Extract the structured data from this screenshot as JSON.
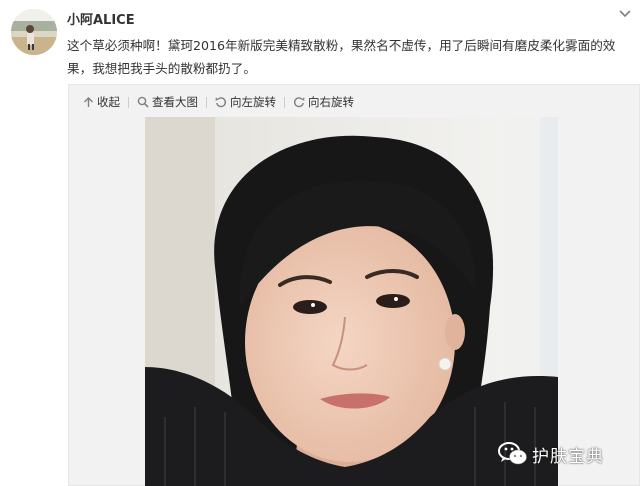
{
  "post": {
    "username": "小阿ALICE",
    "text": "这个草必须种啊！黛珂2016年新版完美精致散粉，果然名不虚传，用了后瞬间有磨皮柔化雾面的效果，我想把我手头的散粉都扔了。"
  },
  "toolbar": {
    "collapse_label": "收起",
    "view_large_label": "查看大图",
    "rotate_left_label": "向左旋转",
    "rotate_right_label": "向右旋转"
  },
  "watermark": {
    "text": "护肤宝典"
  },
  "colors": {
    "text": "#333333",
    "media_background": "#f2f2f2",
    "link_icon": "#808080"
  },
  "icons": [
    "chevron-down-icon",
    "collapse-arrow-icon",
    "magnifier-icon",
    "rotate-left-icon",
    "rotate-right-icon",
    "wechat-icon"
  ]
}
